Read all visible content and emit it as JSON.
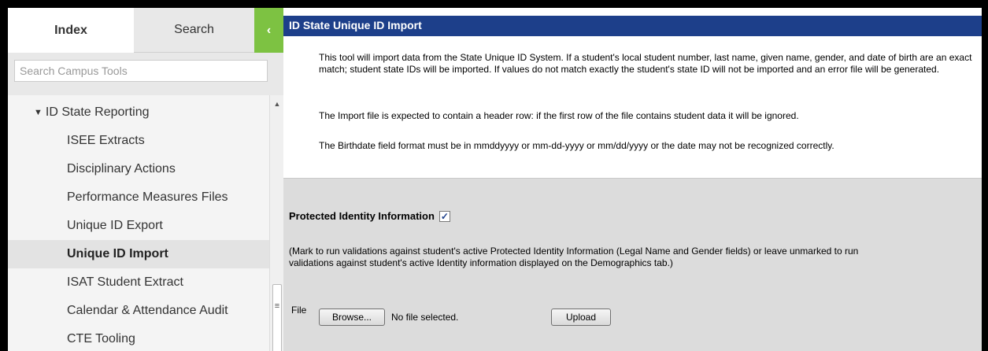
{
  "sidebar": {
    "tabs": {
      "index": "Index",
      "search": "Search",
      "collapse": "‹"
    },
    "search_placeholder": "Search Campus Tools",
    "section": {
      "arrow": "▼",
      "label": "ID State Reporting"
    },
    "items": [
      {
        "label": "ISEE Extracts"
      },
      {
        "label": "Disciplinary Actions"
      },
      {
        "label": "Performance Measures Files"
      },
      {
        "label": "Unique ID Export"
      },
      {
        "label": "Unique ID Import"
      },
      {
        "label": "ISAT Student Extract"
      },
      {
        "label": "Calendar & Attendance Audit"
      },
      {
        "label": "CTE Tooling"
      }
    ],
    "active_item": "Unique ID Import"
  },
  "main": {
    "title": "ID State Unique ID Import",
    "paragraphs": [
      "This tool will import data from the State Unique ID System. If a student's local student number, last name, given name, gender, and date of birth are an exact match; student state IDs will be imported. If values do not match exactly the student's state ID will not be imported and an error file will be generated.",
      "The Import file is expected to contain a header row: if the first row of the file contains student data it will be ignored.",
      "The Birthdate field format must be in mmddyyyy or mm-dd-yyyy or mm/dd/yyyy or the date may not be recognized correctly."
    ],
    "pii": {
      "label": "Protected Identity Information",
      "checked": true,
      "check_glyph": "✓",
      "note": "(Mark to run validations against student's active Protected Identity Information (Legal Name and Gender fields) or leave unmarked to run validations against student's active Identity information displayed on the Demographics tab.)"
    },
    "file": {
      "label": "File",
      "browse_label": "Browse...",
      "status": "No file selected.",
      "upload_label": "Upload"
    }
  },
  "colors": {
    "header_bg": "#1d3f8a",
    "collapse_bg": "#7dc242",
    "form_bg": "#dcdcdc"
  }
}
